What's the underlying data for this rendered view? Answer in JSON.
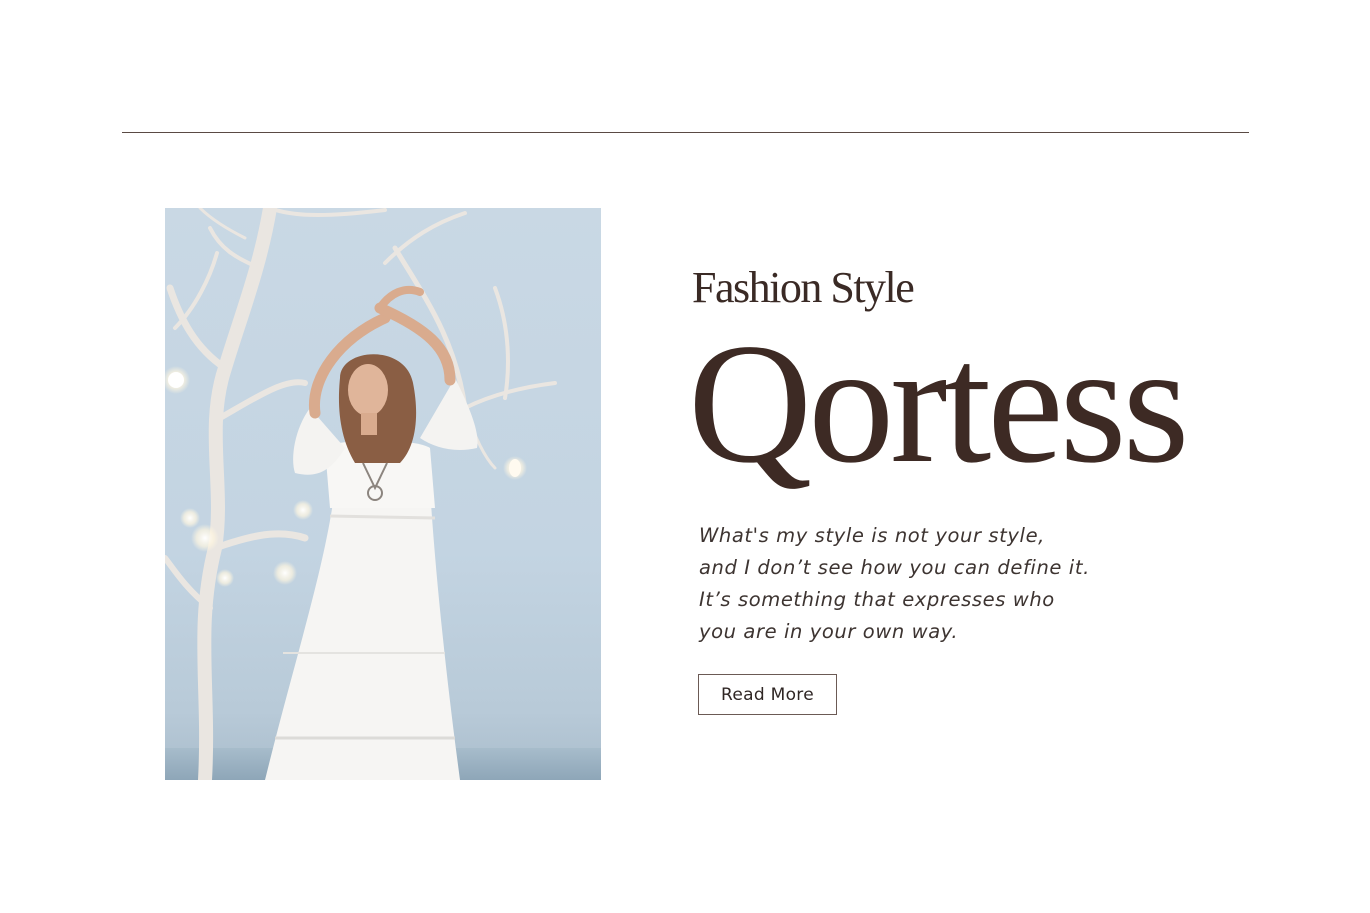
{
  "header": {
    "subtitle": "Fashion Style",
    "brand": "Qortess"
  },
  "quote": {
    "lines": [
      "What's my style is not your style,",
      "and I don’t see how you can define it.",
      "It’s something that expresses who",
      "you are in your own way."
    ]
  },
  "cta": {
    "label": "Read More"
  },
  "colors": {
    "accent": "#3d2a24",
    "rule": "#5a4a44",
    "text": "#3d3431"
  }
}
